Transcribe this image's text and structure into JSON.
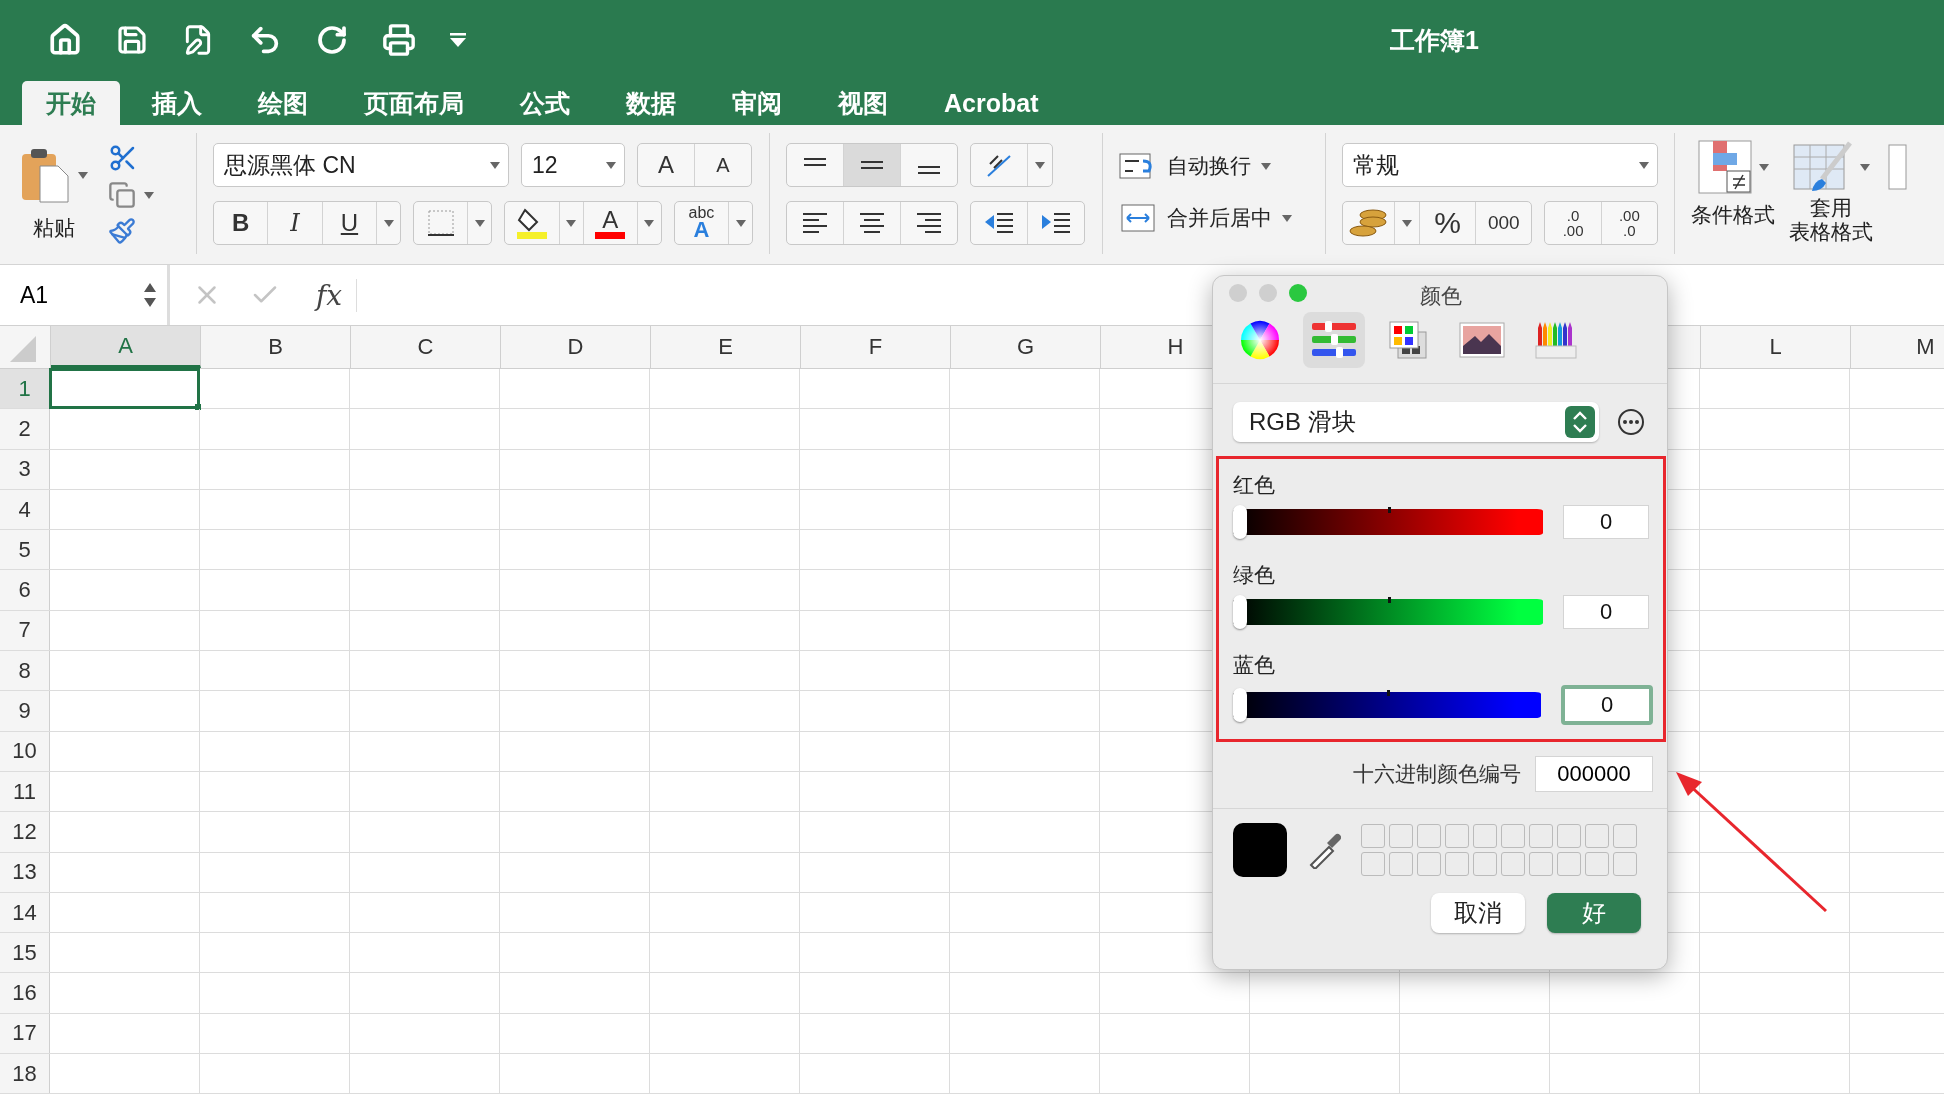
{
  "window": {
    "title": "工作簿1"
  },
  "ribbon_tabs": [
    {
      "label": "开始",
      "selected": true
    },
    {
      "label": "插入",
      "selected": false
    },
    {
      "label": "绘图",
      "selected": false
    },
    {
      "label": "页面布局",
      "selected": false
    },
    {
      "label": "公式",
      "selected": false
    },
    {
      "label": "数据",
      "selected": false
    },
    {
      "label": "审阅",
      "selected": false
    },
    {
      "label": "视图",
      "selected": false
    },
    {
      "label": "Acrobat",
      "selected": false
    }
  ],
  "ribbon": {
    "paste_label": "粘贴",
    "font_name": "思源黑体 CN",
    "font_size": "12",
    "grow_font": "A",
    "shrink_font": "A",
    "bold": "B",
    "italic": "I",
    "underline": "U",
    "font_color_letter": "A",
    "text_effects": "abc",
    "text_effects_letter": "A",
    "wrap_text": "自动换行",
    "merge_center": "合并后居中",
    "number_format": "常规",
    "percent": "%",
    "comma": "000",
    "decrease_decimal": [
      ".0",
      ".00"
    ],
    "increase_decimal": [
      ".00",
      ".0"
    ],
    "conditional_format": "条件格式",
    "table_format": [
      "套用",
      "表格格式"
    ]
  },
  "formula_bar": {
    "name_box": "A1",
    "fx": "fx"
  },
  "columns_left": [
    {
      "label": "A",
      "selected": true
    },
    {
      "label": "B",
      "selected": false
    },
    {
      "label": "C",
      "selected": false
    },
    {
      "label": "D",
      "selected": false
    },
    {
      "label": "E",
      "selected": false
    },
    {
      "label": "F",
      "selected": false
    },
    {
      "label": "G",
      "selected": false
    },
    {
      "label": "H",
      "selected": false
    }
  ],
  "columns_right": [
    {
      "label": "L",
      "selected": false
    },
    {
      "label": "M",
      "selected": false
    }
  ],
  "rows": [
    {
      "label": "1",
      "selected": true
    },
    {
      "label": "2",
      "selected": false
    },
    {
      "label": "3",
      "selected": false
    },
    {
      "label": "4",
      "selected": false
    },
    {
      "label": "5",
      "selected": false
    },
    {
      "label": "6",
      "selected": false
    },
    {
      "label": "7",
      "selected": false
    },
    {
      "label": "8",
      "selected": false
    },
    {
      "label": "9",
      "selected": false
    },
    {
      "label": "10",
      "selected": false
    },
    {
      "label": "11",
      "selected": false
    },
    {
      "label": "12",
      "selected": false
    },
    {
      "label": "13",
      "selected": false
    },
    {
      "label": "14",
      "selected": false
    },
    {
      "label": "15",
      "selected": false
    },
    {
      "label": "16",
      "selected": false
    },
    {
      "label": "17",
      "selected": false
    },
    {
      "label": "18",
      "selected": false
    }
  ],
  "color_dialog": {
    "title": "颜色",
    "picker_tabs": [
      {
        "kind": "wheel",
        "selected": false
      },
      {
        "kind": "sliders",
        "selected": true
      },
      {
        "kind": "palettes",
        "selected": false
      },
      {
        "kind": "image",
        "selected": false
      },
      {
        "kind": "pencils",
        "selected": false
      }
    ],
    "mode": "RGB 滑块",
    "sliders": [
      {
        "label": "红色",
        "color": "#ff0000",
        "level": 0,
        "value": "0",
        "focused": false
      },
      {
        "label": "绿色",
        "color": "#00ff40",
        "level": 0,
        "value": "0",
        "focused": false
      },
      {
        "label": "蓝色",
        "color": "#0000ff",
        "level": 0,
        "value": "0",
        "focused": true
      }
    ],
    "hex_label": "十六进制颜色编号",
    "hex_value": "000000",
    "cancel": "取消",
    "ok": "好"
  }
}
